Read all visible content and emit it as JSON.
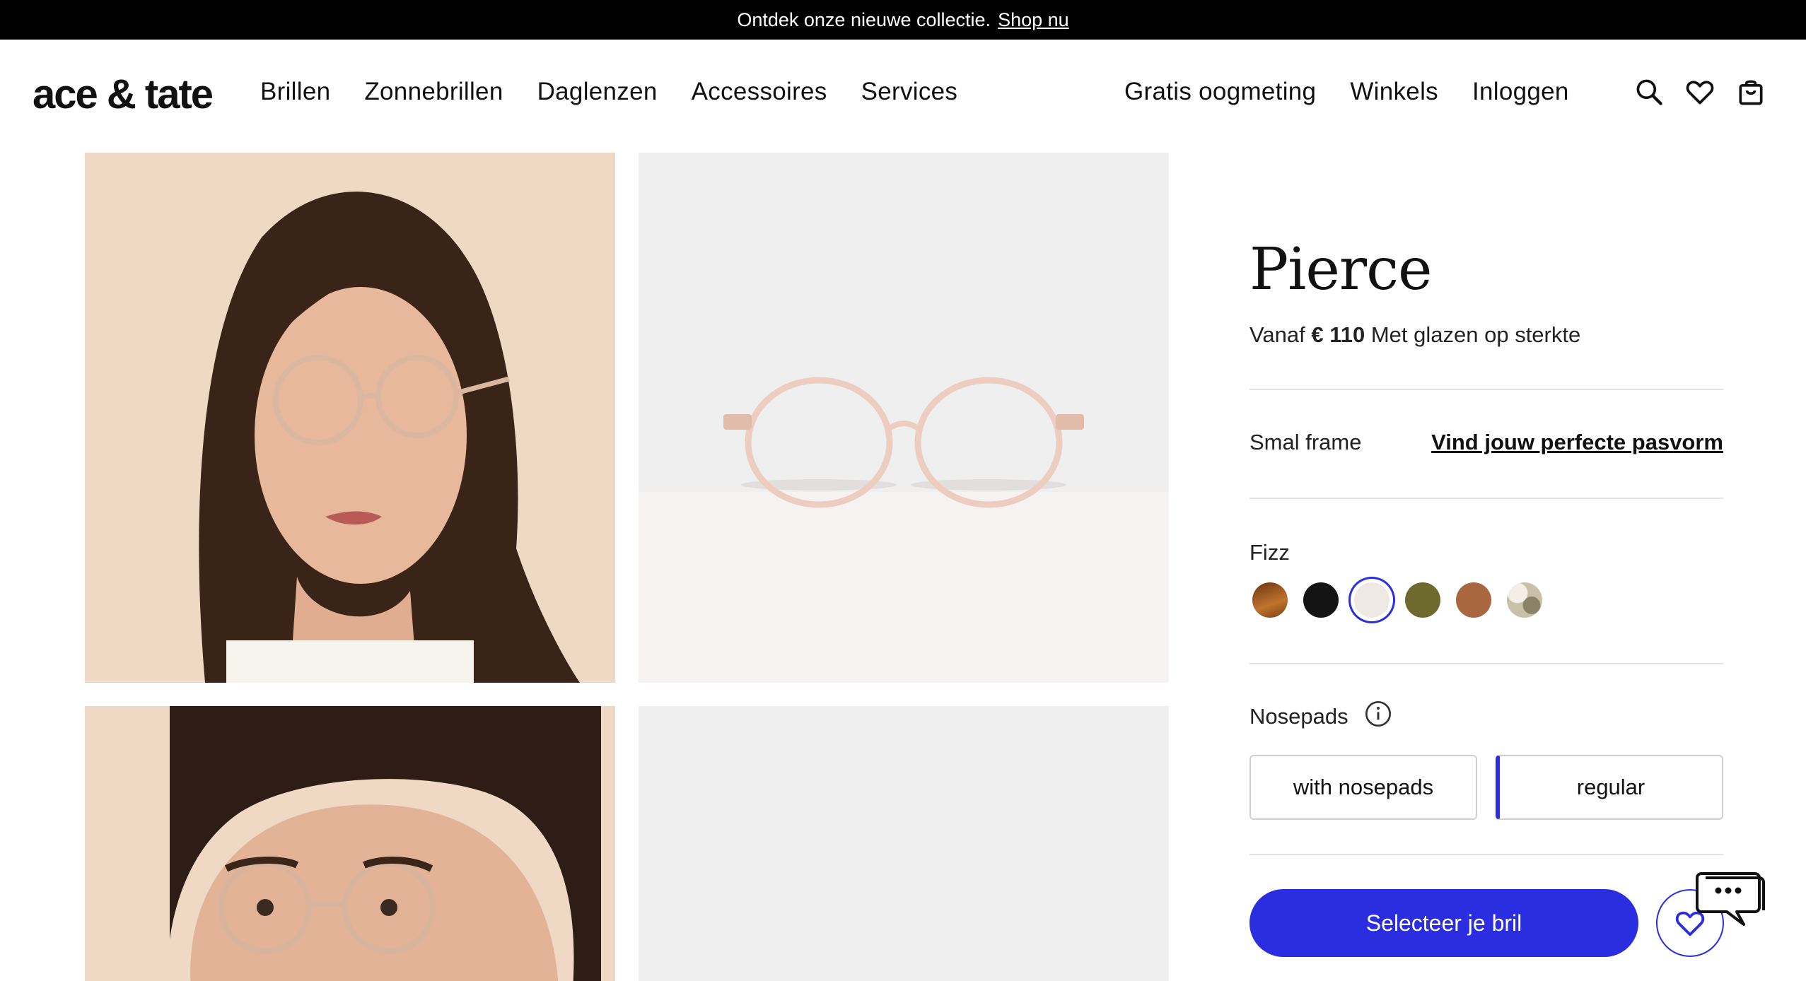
{
  "announcement": {
    "text": "Ontdek onze nieuwe collectie.",
    "link": "Shop nu"
  },
  "brand": {
    "logo": "ace & tate"
  },
  "nav": {
    "left": [
      "Brillen",
      "Zonnebrillen",
      "Daglenzen",
      "Accessoires",
      "Services"
    ],
    "right": [
      "Gratis oogmeting",
      "Winkels",
      "Inloggen"
    ]
  },
  "header_icons": [
    "search-icon",
    "heart-icon",
    "bag-icon"
  ],
  "product": {
    "name": "Pierce",
    "price_prefix": "Vanaf",
    "price": "€ 110",
    "price_suffix": "Met glazen op sterkte",
    "fit_label": "Smal frame",
    "fit_link": "Vind jouw perfecte pasvorm",
    "color_name": "Fizz",
    "colors": [
      {
        "name": "tortoise-brown",
        "hex": "#8a4a17",
        "selected": false
      },
      {
        "name": "black",
        "hex": "#141414",
        "selected": false
      },
      {
        "name": "fizz",
        "hex": "#efe9e4",
        "selected": true
      },
      {
        "name": "olive",
        "hex": "#6e6a2e",
        "selected": false
      },
      {
        "name": "cognac",
        "hex": "#a8673f",
        "selected": false
      },
      {
        "name": "camo",
        "hex": "#c9c0a8",
        "selected": false
      }
    ],
    "nosepads_label": "Nosepads",
    "nosepads_options": [
      "with nosepads",
      "regular"
    ],
    "nosepads_selected": "regular",
    "cta": "Selecteer je bril"
  },
  "colors": {
    "accent": "#2b2ee0",
    "announce_bg": "#000000"
  }
}
